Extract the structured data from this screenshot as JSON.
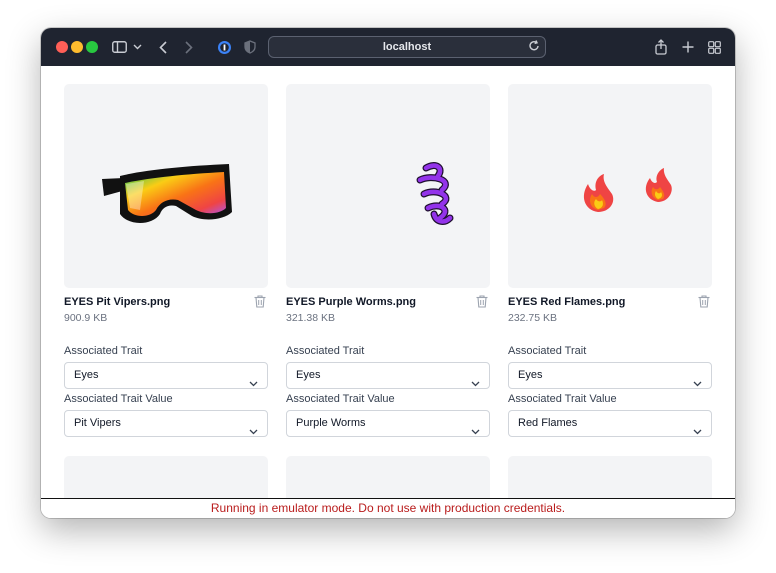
{
  "browser": {
    "url": "localhost",
    "colors": {
      "titlebar": "#1f2430",
      "close": "#ff5f57",
      "minimize": "#febc2e",
      "zoom": "#28c840"
    }
  },
  "cards": [
    {
      "file_name": "EYES Pit Vipers.png",
      "file_size": "900.9 KB",
      "trait_label": "Associated Trait",
      "trait_value": "Eyes",
      "value_label": "Associated Trait Value",
      "value_value": "Pit Vipers",
      "image": "rainbow-sunglasses"
    },
    {
      "file_name": "EYES Purple Worms.png",
      "file_size": "321.38 KB",
      "trait_label": "Associated Trait",
      "trait_value": "Eyes",
      "value_label": "Associated Trait Value",
      "value_value": "Purple Worms",
      "image": "purple-worms"
    },
    {
      "file_name": "EYES Red Flames.png",
      "file_size": "232.75 KB",
      "trait_label": "Associated Trait",
      "trait_value": "Eyes",
      "value_label": "Associated Trait Value",
      "value_value": "Red Flames",
      "image": "red-flames"
    }
  ],
  "banner": {
    "text": "Running in emulator mode. Do not use with production credentials.",
    "color": "#b91c1c"
  }
}
